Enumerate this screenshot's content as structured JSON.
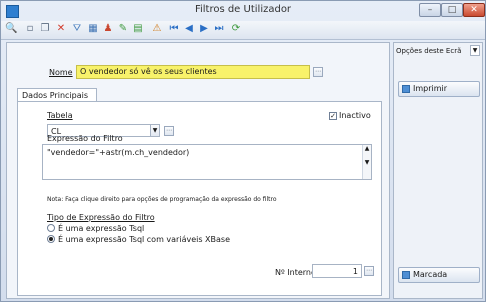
{
  "window": {
    "title": "Filtros de Utilizador",
    "controls": {
      "minimize": "–",
      "maximize": "□",
      "close": "✕"
    }
  },
  "toolbar": {
    "buttons": [
      {
        "icon": "search-icon",
        "glyph": "🔍",
        "color": "#3a6fb0"
      },
      {
        "icon": "new-document-icon",
        "glyph": "▫",
        "color": "#5b6b80"
      },
      {
        "icon": "copy-document-icon",
        "glyph": "❐",
        "color": "#5b6b80"
      },
      {
        "icon": "delete-icon",
        "glyph": "✕",
        "color": "#d23a2a"
      },
      {
        "icon": "filter-icon",
        "glyph": "⛛",
        "color": "#4a7fbf"
      },
      {
        "icon": "grid-icon",
        "glyph": "▦",
        "color": "#3f73b3"
      },
      {
        "icon": "users-icon",
        "glyph": "♟",
        "color": "#c9462f"
      },
      {
        "icon": "edit-icon",
        "glyph": "✎",
        "color": "#3e9a3e"
      },
      {
        "icon": "chart-icon",
        "glyph": "▤",
        "color": "#3e9a3e"
      },
      {
        "icon": "warning-icon",
        "glyph": "⚠",
        "color": "#cf7a1a"
      },
      {
        "icon": "first-record-icon",
        "glyph": "⏮",
        "color": "#2b6fc5"
      },
      {
        "icon": "previous-record-icon",
        "glyph": "◀",
        "color": "#2b6fc5"
      },
      {
        "icon": "next-record-icon",
        "glyph": "▶",
        "color": "#2b6fc5"
      },
      {
        "icon": "last-record-icon",
        "glyph": "⏭",
        "color": "#2b6fc5"
      },
      {
        "icon": "refresh-icon",
        "glyph": "⟳",
        "color": "#3e9a3e"
      }
    ]
  },
  "form": {
    "nome_label": "Nome",
    "nome_value": "O vendedor só vê os seus clientes",
    "tab_label": "Dados Principais",
    "tabela_label": "Tabela",
    "tabela_value": "CL",
    "inactivo_label": "Inactivo",
    "inactivo_checked": true,
    "expressao_label": "Expressão do Filtro",
    "expressao_value": "\"vendedor=\"+astr(m.ch_vendedor)",
    "nota": "Nota: Faça clique direito para opções de programação da expressão do filtro",
    "tipo_label": "Tipo de Expressão do Filtro",
    "tipo_options": [
      {
        "label": "É uma expressão Tsql",
        "selected": false
      },
      {
        "label": "É uma expressão Tsql com variáveis XBase",
        "selected": true
      }
    ],
    "ninterno_label": "Nº Interno",
    "ninterno_value": "1"
  },
  "side": {
    "options_label": "Opções deste Ecrã",
    "imprimir_label": "Imprimir",
    "marcada_label": "Marcada"
  },
  "colors": {
    "highlight_field": "#f8f26a",
    "titlebar": "#d8e2f0"
  }
}
